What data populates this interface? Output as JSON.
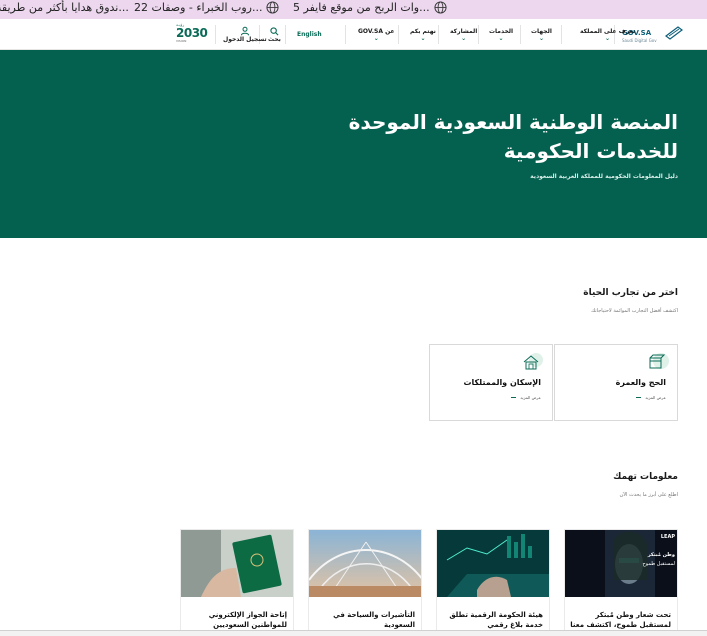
{
  "bookmarks": [
    {
      "label": "...ندوق هدايا بأكثر من طريقة"
    },
    {
      "label": "...روب الخبراء - وصفات 22"
    },
    {
      "label": "...وات الربح من موقع فايفر 5"
    }
  ],
  "nav": {
    "brand": "GOV.SA",
    "brand_sub": "Saudi Digital Gov",
    "items": [
      {
        "label": "تعرف على المملكة"
      },
      {
        "label": "الجهات"
      },
      {
        "label": "الخدمات"
      },
      {
        "label": "المشاركة"
      },
      {
        "label": "نهتم بكم"
      },
      {
        "label": "عن GOV.SA"
      }
    ],
    "language": "English",
    "search_label": "بحث",
    "login_label": "تسجيل الدخول",
    "vision_top": "رؤيـة",
    "vision_num": "2030",
    "vision_sub": "VISION"
  },
  "hero": {
    "title_line1": "المنصة الوطنية السعودية الموحدة",
    "title_line2": "للخدمات الحكومية",
    "subtitle": "دليل المعلومات الحكومية للمملكة العربية السعودية"
  },
  "life": {
    "title": "اختر من تجارب الحياة",
    "subtitle": "اكتشف أفضل التجارب الموائمة لاحتياجاتك",
    "cards": [
      {
        "title": "الحج والعمرة",
        "more": "عرض المزيد"
      },
      {
        "title": "الإسكان والممتلكات",
        "more": "عرض المزيد"
      }
    ]
  },
  "info": {
    "title": "معلومات تهمك",
    "subtitle": "اطلع على أبرز ما يحدث الآن",
    "news": [
      {
        "title": "تحت شعار وطن مُبتكر لمستقبل طموح، اكتشف معنا",
        "img_line1": "LEAP",
        "img_line2": "وطن مُبتكر",
        "img_line3": "لمستقبل طموح"
      },
      {
        "title": "هيئة الحكومة الرقمية تطلق خدمة بلاغ رقمي"
      },
      {
        "title": "التأشيرات والسياحة في السعودية"
      },
      {
        "title": "إتاحة الجواز الإلكتروني للمواطنين السعوديين"
      }
    ]
  },
  "colors": {
    "primary": "#04604f",
    "bookmark_bar": "#ecd7ee",
    "accent": "#0b6b57"
  }
}
